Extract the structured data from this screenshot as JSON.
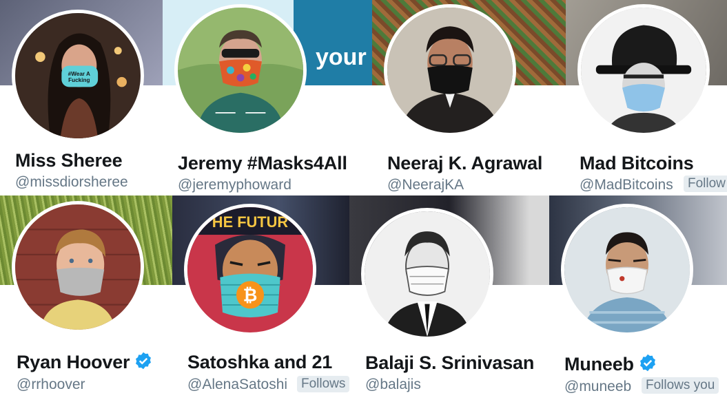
{
  "profiles": [
    {
      "name": "Miss Sheree",
      "handle": "@missdiorsheree",
      "follows_you": "",
      "verified": false,
      "banner_color": "#7c7f95",
      "mask_text": "#Wear A Fucking Mask"
    },
    {
      "name": "Jeremy #Masks4All",
      "handle": "@jeremyphoward",
      "follows_you": "",
      "verified": false,
      "banner_color": "#1f7da6",
      "banner_text": "your"
    },
    {
      "name": "Neeraj K. Agrawal",
      "handle": "@NeerajKA",
      "follows_you": "",
      "verified": false,
      "banner_color": "#8a5a3a"
    },
    {
      "name": "Mad Bitcoins",
      "handle": "@MadBitcoins",
      "follows_you": "Follow",
      "verified": false,
      "banner_color": "#8e8a83"
    },
    {
      "name": "Ryan Hoover",
      "handle": "@rrhoover",
      "follows_you": "",
      "verified": true,
      "banner_color": "#8fa24a"
    },
    {
      "name": "Satoshka and 21",
      "handle": "@AlenaSatoshi",
      "follows_you": "Follows",
      "verified": false,
      "banner_color": "#3a3f52",
      "avatar_text": "HE FUTUR"
    },
    {
      "name": "Balaji S. Srinivasan",
      "handle": "@balajis",
      "follows_you": "",
      "verified": false,
      "banner_color": "#2c2c30"
    },
    {
      "name": "Muneeb",
      "handle": "@muneeb",
      "follows_you": "Follows you",
      "verified": true,
      "banner_color": "#3e4656"
    }
  ],
  "colors": {
    "verified": "#1da1f2",
    "name": "#14171a",
    "handle": "#657786",
    "badge_bg": "#e6ecf0"
  }
}
